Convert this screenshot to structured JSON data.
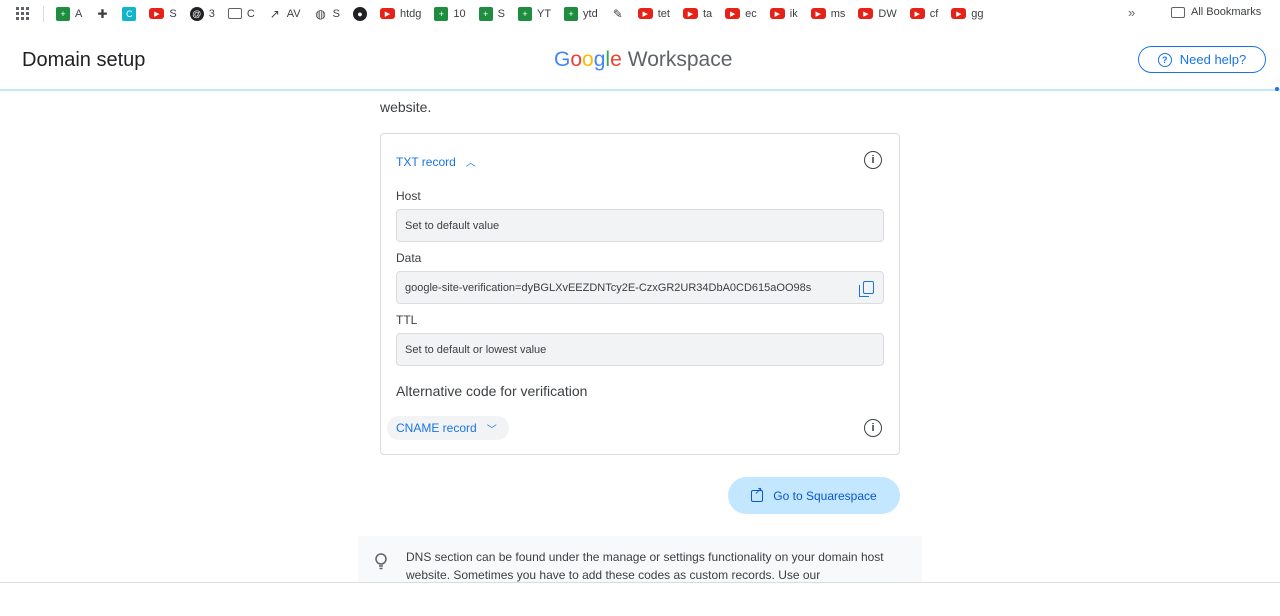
{
  "bookmarks": [
    {
      "icon": "sheets-icon",
      "label": "A"
    },
    {
      "icon": "puzzle-icon",
      "label": ""
    },
    {
      "icon": "teal-app-icon",
      "label": ""
    },
    {
      "icon": "youtube-icon",
      "label": "S"
    },
    {
      "icon": "threads-icon",
      "label": "3"
    },
    {
      "icon": "folder-icon",
      "label": "C"
    },
    {
      "icon": "trend-icon",
      "label": "AV"
    },
    {
      "icon": "globe-icon",
      "label": "S"
    },
    {
      "icon": "github-icon",
      "label": ""
    },
    {
      "icon": "youtube-icon",
      "label": "htdg"
    },
    {
      "icon": "sheets-icon",
      "label": "10"
    },
    {
      "icon": "sheets-icon",
      "label": "S"
    },
    {
      "icon": "sheets-icon",
      "label": "YT"
    },
    {
      "icon": "sheets-icon",
      "label": "ytd"
    },
    {
      "icon": "pin-icon",
      "label": ""
    },
    {
      "icon": "youtube-icon",
      "label": "tet"
    },
    {
      "icon": "youtube-icon",
      "label": "ta"
    },
    {
      "icon": "youtube-icon",
      "label": "ec"
    },
    {
      "icon": "youtube-icon",
      "label": "ik"
    },
    {
      "icon": "youtube-icon",
      "label": "ms"
    },
    {
      "icon": "youtube-icon",
      "label": "DW"
    },
    {
      "icon": "youtube-icon",
      "label": "cf"
    },
    {
      "icon": "youtube-icon",
      "label": "gg"
    }
  ],
  "bookmarks_more": "»",
  "all_bookmarks": "All Bookmarks",
  "header": {
    "title": "Domain setup",
    "brand_google": [
      "G",
      "o",
      "o",
      "g",
      "l",
      "e"
    ],
    "brand_workspace": "Workspace",
    "help_label": "Need help?"
  },
  "main": {
    "intro_tail": "website.",
    "txt_record_label": "TXT record",
    "host_label": "Host",
    "host_value": "Set to default value",
    "data_label": "Data",
    "data_value": "google-site-verification=dyBGLXvEEZDNTcy2E-CzxGR2UR34DbA0CD615aOO98s",
    "ttl_label": "TTL",
    "ttl_value": "Set to default or lowest value",
    "alt_heading": "Alternative code for verification",
    "cname_label": "CNAME record",
    "go_button": "Go to Squarespace",
    "tip_text": "DNS section can be found under the manage or settings functionality on your domain host website. Sometimes you have to add these codes as custom records. Use our"
  },
  "colors": {
    "accent": "#1a73e8",
    "go_button_bg": "#c2e7ff",
    "youtube": "#e62117",
    "sheets": "#1e8e3e"
  }
}
